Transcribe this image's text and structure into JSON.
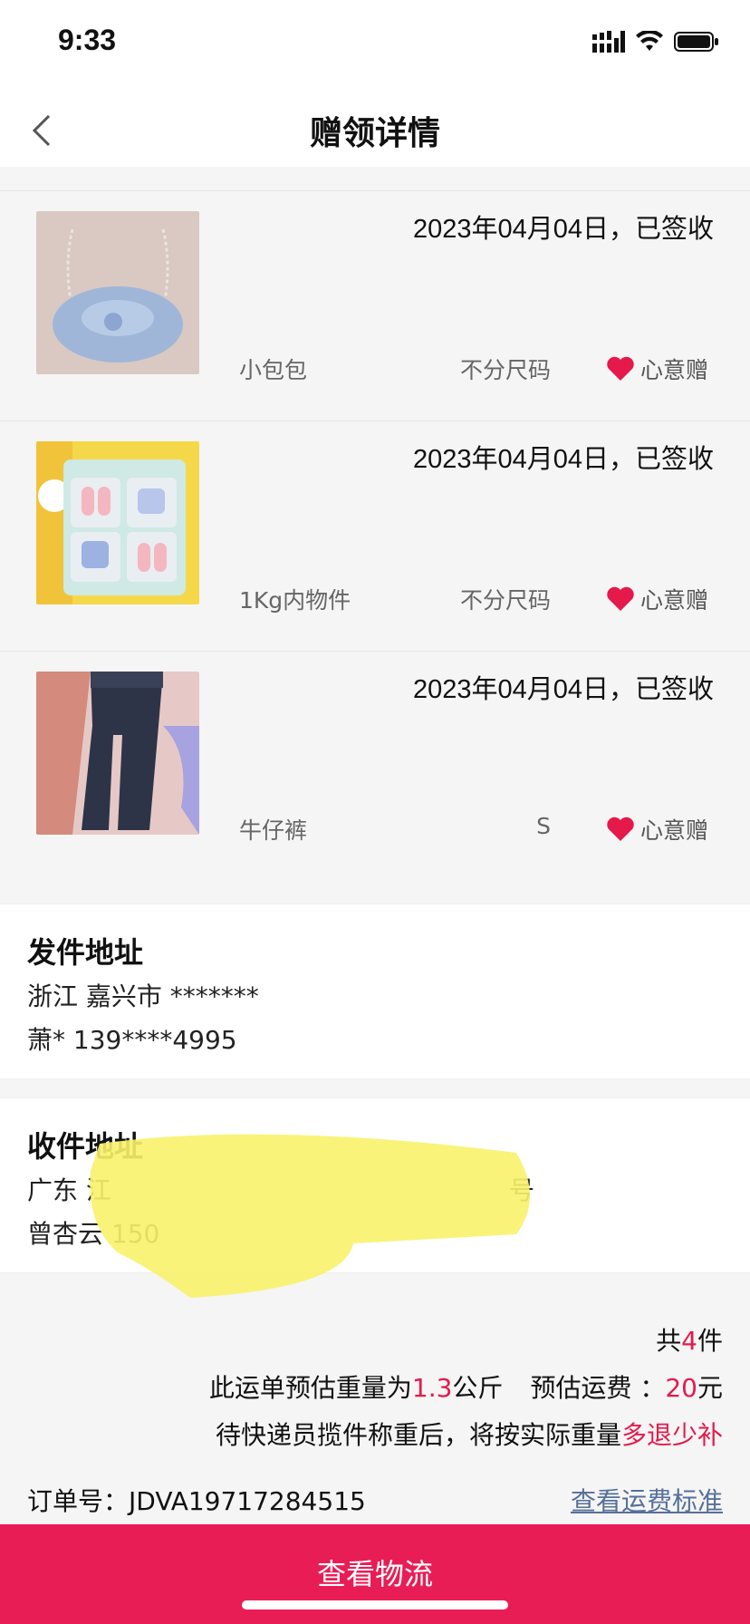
{
  "status": {
    "time": "9:33"
  },
  "header": {
    "title": "赠领详情"
  },
  "items": [
    {
      "date": "2023年04月04日，已签收",
      "name": "小包包",
      "size": "不分尺码",
      "tag": "心意赠"
    },
    {
      "date": "2023年04月04日，已签收",
      "name": "1Kg内物件",
      "size": "不分尺码",
      "tag": "心意赠"
    },
    {
      "date": "2023年04月04日，已签收",
      "name": "牛仔裤",
      "size": "S",
      "tag": "心意赠"
    }
  ],
  "sender": {
    "title": "发件地址",
    "region": "浙江 嘉兴市 *******",
    "contact": "萧* 139****4995"
  },
  "receiver": {
    "title": "收件地址",
    "region": "广东 江",
    "region_end": "号",
    "contact": "曾杏云 150"
  },
  "summary": {
    "count_prefix": "共",
    "count": "4",
    "count_suffix": "件",
    "weight_prefix": "此运单预估重量为",
    "weight": "1.3",
    "weight_unit": "公斤",
    "fee_label": "预估运费 ：",
    "fee": "20",
    "fee_unit": "元",
    "note_prefix": "待快递员揽件称重后，将按实际重量",
    "note_highlight": "多退少补"
  },
  "order": {
    "label": "订单号：",
    "number": "JDVA19717284515",
    "fee_link": "查看运费标准"
  },
  "footer": {
    "button": "查看物流"
  },
  "colors": {
    "accent": "#e5194a",
    "button": "#e91d55",
    "link": "#56709a"
  }
}
